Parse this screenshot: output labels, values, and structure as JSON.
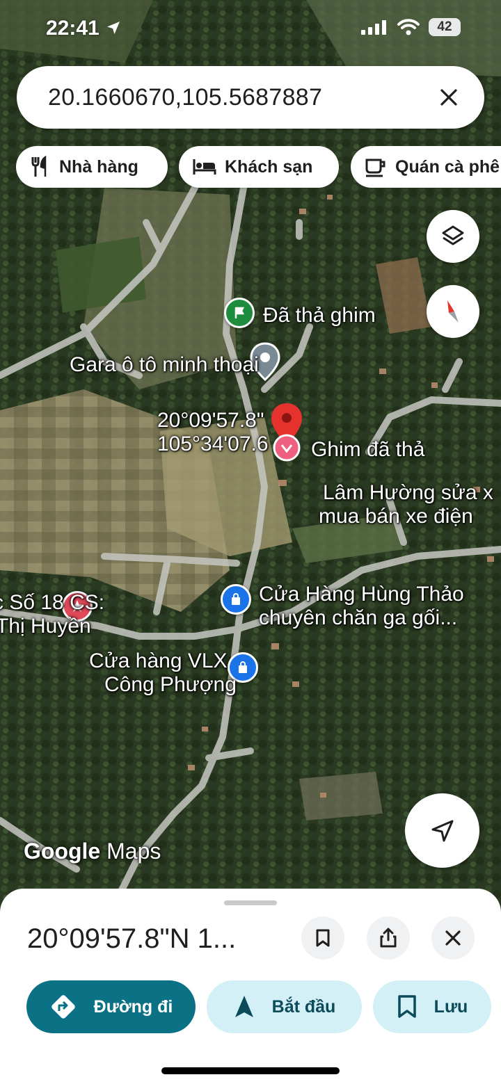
{
  "status_bar": {
    "time": "22:41",
    "battery": "42"
  },
  "search": {
    "query": "20.1660670,105.5687887"
  },
  "chips": [
    {
      "label": "Nhà hàng",
      "icon": "restaurant-icon"
    },
    {
      "label": "Khách sạn",
      "icon": "hotel-bed-icon"
    },
    {
      "label": "Quán cà phê",
      "icon": "coffee-cup-icon"
    }
  ],
  "map": {
    "labels": {
      "dropped_pin_top": "Đã thả ghim",
      "garage": "Gara ô tô minh thoại",
      "coord_lat": "20°09'57.8\"",
      "coord_lng": "105°34'07.6",
      "dropped_pin": "Ghim đã thả",
      "lam_huong_1": "Lâm Hường sửa x",
      "lam_huong_2": "mua bán xe điện",
      "hung_thao_1": "Cửa Hàng Hùng Thảo",
      "hung_thao_2": "chuyên chăn ga gối...",
      "vlx_1": "Cửa hàng VLX",
      "vlx_2": "Công Phượng",
      "left_1": "c Số 18 CS:",
      "left_2": "Thị Huyền"
    },
    "attribution": {
      "google": "Google",
      "maps": "Maps"
    }
  },
  "sheet": {
    "title": "20°09'57.8\"N 1...",
    "actions": {
      "directions": "Đường đi",
      "start": "Bắt đầu",
      "save": "Lưu"
    }
  },
  "colors": {
    "primary": "#0b7285",
    "light_teal": "#d3f0f7",
    "pin_red": "#e5322d",
    "pin_pink": "#ef5f80",
    "pin_green": "#1e8e3e",
    "pin_blue": "#1a73e8",
    "pin_grey": "#7a8a94"
  }
}
